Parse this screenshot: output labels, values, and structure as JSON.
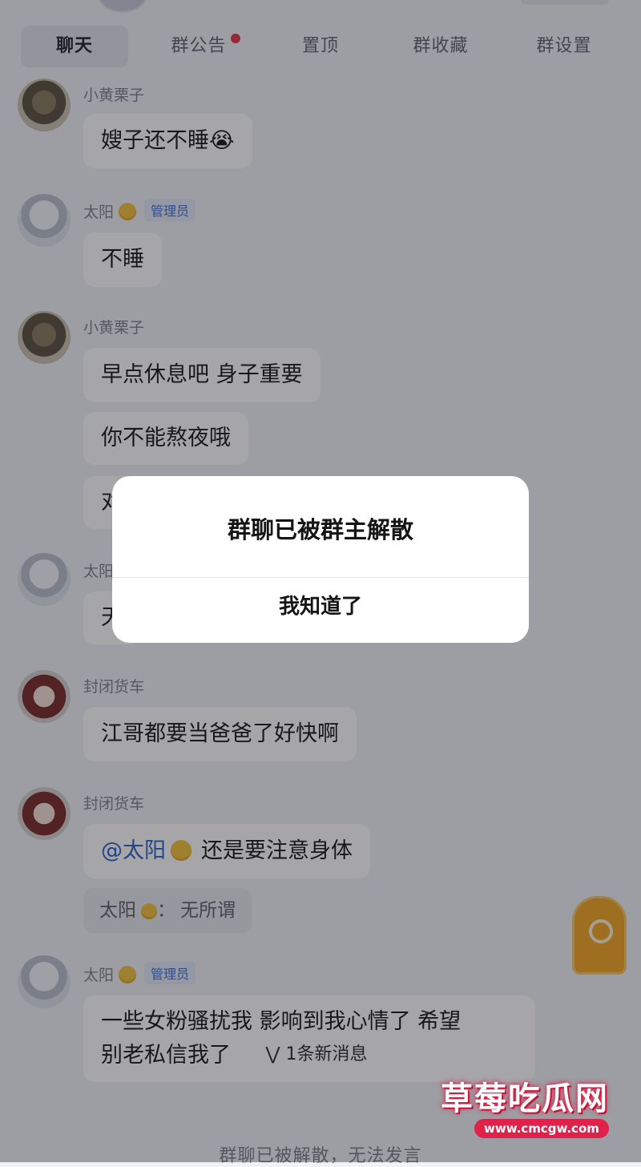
{
  "tabs": [
    {
      "label": "聊天",
      "active": true
    },
    {
      "label": "群公告",
      "badge": true
    },
    {
      "label": "置顶"
    },
    {
      "label": "群收藏"
    },
    {
      "label": "群设置"
    }
  ],
  "messages": [
    {
      "sender": "小黄栗子",
      "text": "嫂子还不睡😭"
    },
    {
      "sender": "太阳",
      "role": "管理员",
      "text": "不睡"
    },
    {
      "sender": "小黄栗子",
      "texts": [
        "早点休息吧 身子重要",
        "你不能熬夜哦",
        "对"
      ]
    },
    {
      "sender": "太阳",
      "text": "天"
    },
    {
      "sender": "封闭货车",
      "text": "江哥都要当爸爸了好快啊"
    },
    {
      "sender": "封闭货车",
      "mention": "@太阳",
      "text": "还是要注意身体",
      "reply": {
        "name": "太阳",
        "sep": "：",
        "text": "无所谓"
      }
    },
    {
      "sender": "太阳",
      "role": "管理员",
      "text_line1": "一些女粉骚扰我 影响到我心情了 希望",
      "text_line2": "别老私信我了"
    }
  ],
  "new_messages_label": "1条新消息",
  "bottom_status": "群聊已被解散，无法发言",
  "dialog": {
    "title": "群聊已被群主解散",
    "button": "我知道了"
  },
  "watermark": {
    "name": "草莓吃瓜网",
    "url": "www.cmcgw.com"
  },
  "colors": {
    "background": "#f1f2f6",
    "admin_badge": "#3f6fd1",
    "mention": "#2e63c8",
    "badge_dot": "#e8334a",
    "watermark": "#e0224a"
  }
}
